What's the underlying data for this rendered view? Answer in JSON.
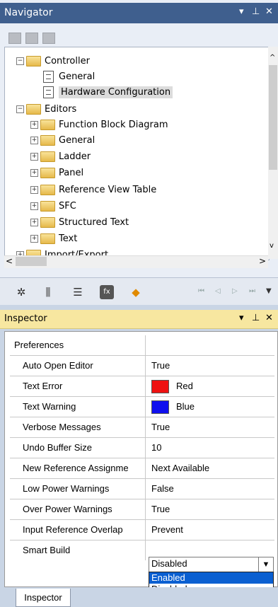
{
  "navigator": {
    "title": "Navigator",
    "ctrl_menu": "▾",
    "ctrl_pin": "⊥",
    "ctrl_close": "✕",
    "tree": [
      {
        "label": "Controller"
      },
      {
        "label": "General"
      },
      {
        "label": "Hardware Configuration"
      },
      {
        "label": "Editors"
      },
      {
        "label": "Function Block Diagram"
      },
      {
        "label": "General"
      },
      {
        "label": "Ladder"
      },
      {
        "label": "Panel"
      },
      {
        "label": "Reference View Table"
      },
      {
        "label": "SFC"
      },
      {
        "label": "Structured Text"
      },
      {
        "label": "Text"
      },
      {
        "label": "Import/Export"
      }
    ],
    "scroll_left": "<",
    "scroll_right": ">",
    "scroll_up": "^",
    "scroll_down": "v",
    "nav_first": "⏮",
    "nav_prev": "◁",
    "nav_next": "▷",
    "nav_last": "⏭",
    "nav_menu": "▼"
  },
  "inspector": {
    "title": "Inspector",
    "ctrl_menu": "▾",
    "ctrl_pin": "⊥",
    "ctrl_close": "✕",
    "section": "Preferences",
    "rows": [
      {
        "key": "Auto Open Editor",
        "value": "True"
      },
      {
        "key": "Text Error",
        "value": "Red",
        "color": "#ee1111"
      },
      {
        "key": "Text Warning",
        "value": "Blue",
        "color": "#1010ee"
      },
      {
        "key": "Verbose Messages",
        "value": "True"
      },
      {
        "key": "Undo Buffer Size",
        "value": "10"
      },
      {
        "key": "New Reference Assignme",
        "value": "Next Available"
      },
      {
        "key": "Low Power Warnings",
        "value": "False"
      },
      {
        "key": "Over Power Warnings",
        "value": "True"
      },
      {
        "key": "Input Reference Overlap",
        "value": "Prevent"
      },
      {
        "key": "Smart Build",
        "value": "Disabled"
      }
    ],
    "dropdown_options": [
      "Enabled",
      "Disabled"
    ],
    "dropdown_highlight": "Enabled",
    "tab": "Inspector"
  },
  "icons": [
    "grid-icon",
    "tree-icon",
    "list-icon",
    "settings-gear-icon",
    "library-icon",
    "table-icon",
    "function-icon",
    "help-icon"
  ]
}
